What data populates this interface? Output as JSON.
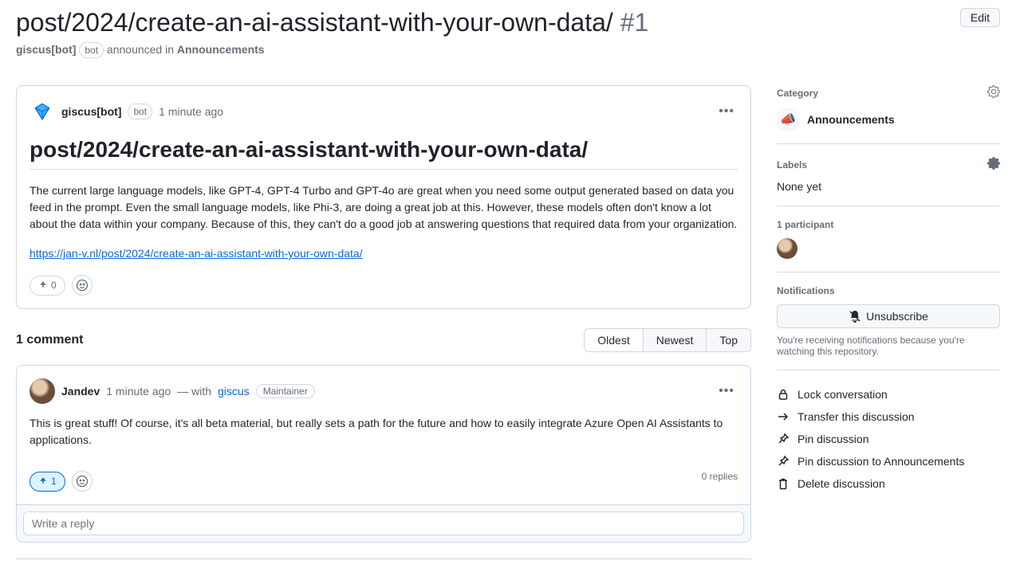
{
  "header": {
    "title": "post/2024/create-an-ai-assistant-with-your-own-data/",
    "issue_number": "#1",
    "edit": "Edit",
    "subhead_author": "giscus[bot]",
    "bot_label": "bot",
    "subhead_action": "announced in",
    "subhead_category": "Announcements"
  },
  "post": {
    "author": "giscus[bot]",
    "bot_label": "bot",
    "time": "1 minute ago",
    "title": "post/2024/create-an-ai-assistant-with-your-own-data/",
    "body": "The current large language models, like GPT-4, GPT-4 Turbo and GPT-4o are great when you need some output generated based on data you feed in the prompt. Even the small language models, like Phi-3, are doing a great job at this. However, these models often don't know a lot about the data within your company. Because of this, they can't do a good job at answering questions that required data from your organization.",
    "link_text": "https://jan-v.nl/post/2024/create-an-ai-assistant-with-your-own-data/",
    "upvotes": "0"
  },
  "comments_header": {
    "count_label": "1 comment",
    "sort": {
      "oldest": "Oldest",
      "newest": "Newest",
      "top": "Top"
    }
  },
  "comment": {
    "author": "Jandev",
    "time": "1 minute ago",
    "via_prefix": "— with",
    "via": "giscus",
    "role": "Maintainer",
    "body": "This is great stuff! Of course, it's all beta material, but really sets a path for the future and how to easily integrate Azure Open AI Assistants to applications.",
    "upvotes": "1",
    "replies": "0 replies",
    "reply_placeholder": "Write a reply"
  },
  "sidebar": {
    "category": {
      "header": "Category",
      "name": "Announcements",
      "emoji": "📣"
    },
    "labels": {
      "header": "Labels",
      "none": "None yet"
    },
    "participants": {
      "header": "1 participant"
    },
    "notifications": {
      "header": "Notifications",
      "button": "Unsubscribe",
      "note": "You're receiving notifications because you're watching this repository."
    },
    "actions": {
      "lock": "Lock conversation",
      "transfer": "Transfer this discussion",
      "pin": "Pin discussion",
      "pin_cat": "Pin discussion to Announcements",
      "delete": "Delete discussion"
    }
  }
}
